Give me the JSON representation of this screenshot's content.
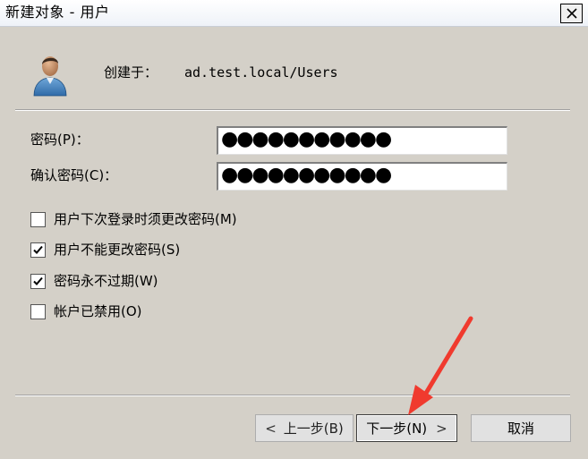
{
  "window": {
    "title": "新建对象 - 用户",
    "close_glyph": "×"
  },
  "header": {
    "create_in_label": "创建于：",
    "create_in_path": "ad.test.local/Users"
  },
  "form": {
    "password_label": "密码(P)：",
    "password_value": "●●●●●●●●●●●",
    "confirm_label": "确认密码(C)：",
    "confirm_value": "●●●●●●●●●●●"
  },
  "options": [
    {
      "label": "用户下次登录时须更改密码(M)",
      "checked": false
    },
    {
      "label": "用户不能更改密码(S)",
      "checked": true
    },
    {
      "label": "密码永不过期(W)",
      "checked": true
    },
    {
      "label": "帐户已禁用(O)",
      "checked": false
    }
  ],
  "buttons": {
    "back_label": "上一步(B)",
    "next_label": "下一步(N)",
    "cancel_label": "取消"
  },
  "icons": {
    "user": "user-icon",
    "checkmark": "checkmark-icon",
    "back_chevron": "chevron-left-icon",
    "next_chevron": "chevron-right-icon",
    "annotation_arrow": "red-arrow-annotation"
  },
  "colors": {
    "dialog_background": "#d4d0c8",
    "annotation": "#f03a2e"
  }
}
